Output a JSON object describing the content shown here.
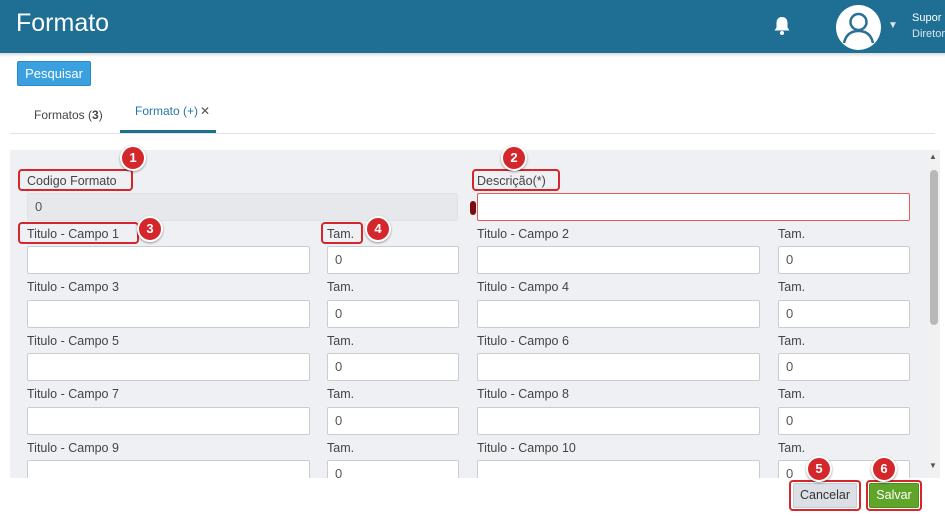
{
  "header": {
    "title": "Formato",
    "user_name": "Supor",
    "user_role": "Diretor"
  },
  "toolbar": {
    "search_label": "Pesquisar"
  },
  "tabs": [
    {
      "label": "Formatos (",
      "count": "3",
      "suffix": ")"
    },
    {
      "label": "Formato (+)",
      "close": "✕"
    }
  ],
  "form": {
    "codigo_label": "Codigo Formato",
    "codigo_value": "0",
    "descricao_label": "Descrição(*)",
    "descricao_value": "",
    "rows": [
      {
        "l_label": "Titulo - Campo 1",
        "l_tam_label": "Tam.",
        "l_tam": "0",
        "r_label": "Titulo - Campo 2",
        "r_tam_label": "Tam.",
        "r_tam": "0"
      },
      {
        "l_label": "Titulo - Campo 3",
        "l_tam_label": "Tam.",
        "l_tam": "0",
        "r_label": "Titulo - Campo 4",
        "r_tam_label": "Tam.",
        "r_tam": "0"
      },
      {
        "l_label": "Titulo - Campo 5",
        "l_tam_label": "Tam.",
        "l_tam": "0",
        "r_label": "Titulo - Campo 6",
        "r_tam_label": "Tam.",
        "r_tam": "0"
      },
      {
        "l_label": "Titulo - Campo 7",
        "l_tam_label": "Tam.",
        "l_tam": "0",
        "r_label": "Titulo - Campo 8",
        "r_tam_label": "Tam.",
        "r_tam": "0"
      },
      {
        "l_label": "Titulo - Campo 9",
        "l_tam_label": "Tam.",
        "l_tam": "0",
        "r_label": "Titulo - Campo 10",
        "r_tam_label": "Tam.",
        "r_tam": "0"
      }
    ]
  },
  "actions": {
    "cancel_label": "Cancelar",
    "save_label": "Salvar"
  },
  "annotations": [
    "1",
    "2",
    "3",
    "4",
    "5",
    "6"
  ],
  "colors": {
    "header_bg": "#1f6e94",
    "accent": "#3aa0e0",
    "save": "#5ea52a",
    "annotation": "#d4272c"
  }
}
